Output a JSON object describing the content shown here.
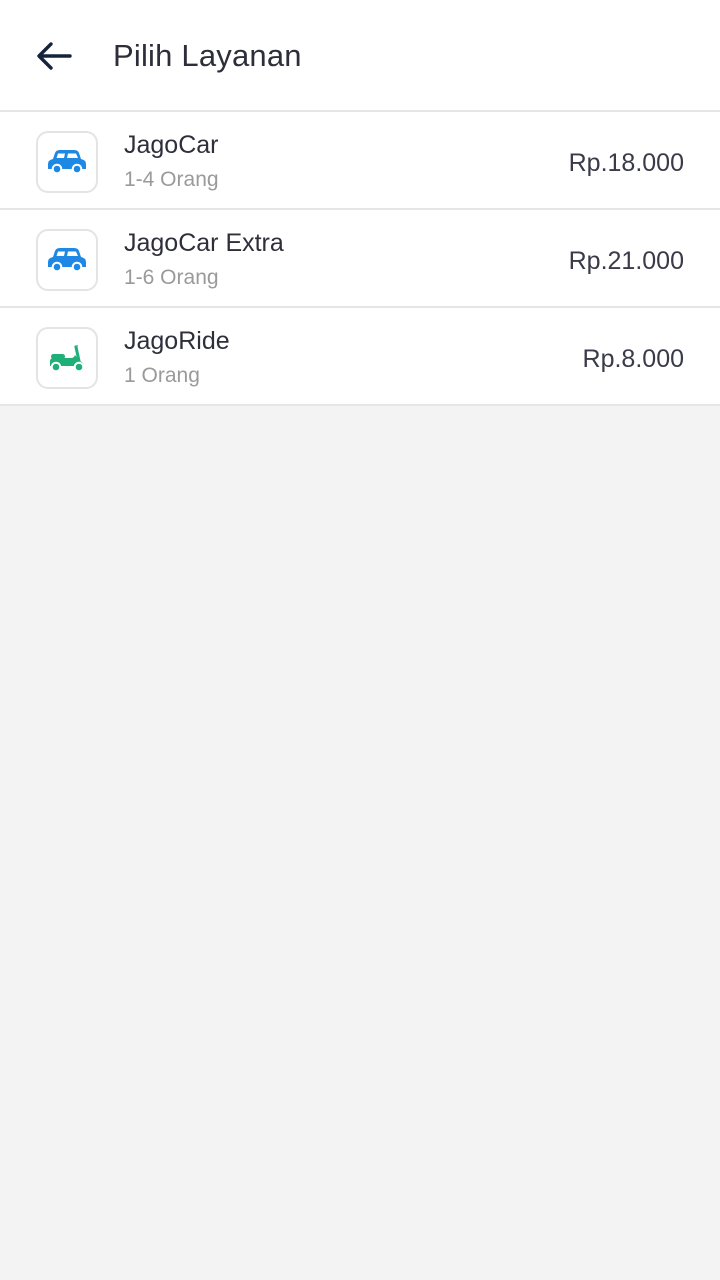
{
  "header": {
    "title": "Pilih Layanan",
    "back_icon": "arrow-left-icon"
  },
  "services": [
    {
      "name": "JagoCar",
      "capacity": "1-4 Orang",
      "price": "Rp.18.000",
      "icon": "car-icon",
      "icon_color": "#1e88e5"
    },
    {
      "name": "JagoCar Extra",
      "capacity": "1-6 Orang",
      "price": "Rp.21.000",
      "icon": "car-icon",
      "icon_color": "#1e88e5"
    },
    {
      "name": "JagoRide",
      "capacity": "1 Orang",
      "price": "Rp.8.000",
      "icon": "scooter-icon",
      "icon_color": "#1fb07a"
    }
  ],
  "colors": {
    "background": "#f3f3f3",
    "surface": "#ffffff",
    "divider": "#e6e6e6",
    "text_primary": "#2f2f3b",
    "text_secondary": "#9a9a9a",
    "back_arrow": "#15233d"
  }
}
